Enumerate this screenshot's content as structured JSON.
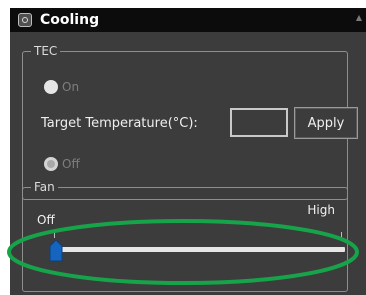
{
  "window": {
    "title": "Cooling",
    "icon": "fan-icon",
    "collapse_icon": "collapse-arrow-icon"
  },
  "tec": {
    "legend": "TEC",
    "on_label": "On",
    "off_label": "Off",
    "selected": "off",
    "target_label": "Target Temperature(°C):",
    "target_value": "",
    "apply_label": "Apply"
  },
  "fan": {
    "legend": "Fan",
    "min_label": "Off",
    "max_label": "High",
    "level": 0
  },
  "colors": {
    "panel_bg": "#3c3c3c",
    "titlebar_bg": "#0c0c0c",
    "slider_thumb": "#1565c0",
    "highlight": "#17a34a"
  }
}
